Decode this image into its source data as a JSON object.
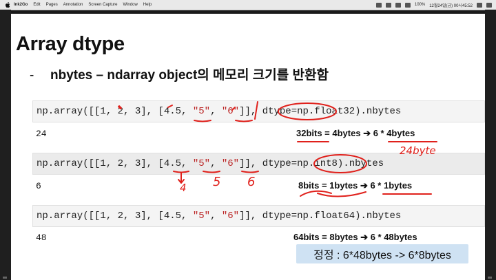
{
  "menubar": {
    "app_name": "Ink2Go",
    "items": [
      "Edit",
      "Pages",
      "Annotation",
      "Screen Capture",
      "Window",
      "Help"
    ],
    "battery": "100%",
    "datetime": "12월24일(금)  00시45:52"
  },
  "slide": {
    "title": "Array dtype",
    "bullet_dash": "-",
    "bullet_text": "nbytes – ndarray object의 메모리 크기를 반환함",
    "cells": [
      {
        "code_prefix": "np.array([[1, 2, 3], [4.5, ",
        "str1": "\"5\"",
        "sep": ", ",
        "str2": "\"6\"",
        "code_suffix": "]], dtype=np.float32).nbytes",
        "output": "24",
        "note": "32bits = 4bytes ➔ 6 * 4bytes"
      },
      {
        "code_prefix": "np.array([[1, 2, 3], [4.5, ",
        "str1": "\"5\"",
        "sep": ", ",
        "str2": "\"6\"",
        "code_suffix": "]], dtype=np.int8).nbytes",
        "output": "6",
        "note": "8bits = 1bytes ➔ 6 * 1bytes"
      },
      {
        "code_prefix": "np.array([[1, 2, 3], [4.5, ",
        "str1": "\"5\"",
        "sep": ", ",
        "str2": "\"6\"",
        "code_suffix": "]], dtype=np.float64).nbytes",
        "output": "48",
        "note": "64bits = 8bytes ➔ 6 * 48bytes"
      }
    ],
    "correction": "정정 : 6*48bytes -> 6*8bytes",
    "handwriting": {
      "bytes_24": "24byte",
      "digit_4": "4",
      "digit_5": "5",
      "digit_6": "6"
    }
  },
  "colors": {
    "annotation_red": "#e0201b",
    "correction_bg": "#cfe2f3",
    "string_color": "#ba2121"
  }
}
